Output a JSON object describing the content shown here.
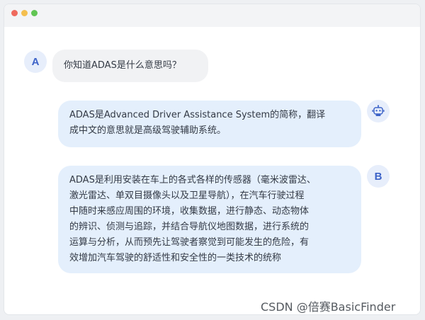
{
  "conversation": {
    "user_a": {
      "avatar_label": "A",
      "message": "你知道ADAS是什么意思吗？"
    },
    "assistant": {
      "avatar_icon": "robot-icon",
      "message": "ADAS是Advanced Driver Assistance System的简称，翻译\n成中文的意思就是高级驾驶辅助系统。"
    },
    "user_b": {
      "avatar_label": "B",
      "message": "ADAS是利用安装在车上的各式各样的传感器（毫米波雷达、\n激光雷达、单双目摄像头以及卫星导航），在汽车行驶过程\n中随时来感应周围的环境，收集数据，进行静态、动态物体\n的辨识、侦测与追踪，并结合导航仪地图数据，进行系统的\n运算与分析，从而预先让驾驶者察觉到可能发生的危险，有\n效增加汽车驾驶的舒适性和安全性的一类技术的统称"
    }
  },
  "watermark": "CSDN @倍赛BasicFinder",
  "colors": {
    "user_bubble": "#f1f2f4",
    "assistant_bubble": "#e4effc",
    "avatar_bg": "#e7eefb",
    "avatar_text": "#3d63c8"
  }
}
